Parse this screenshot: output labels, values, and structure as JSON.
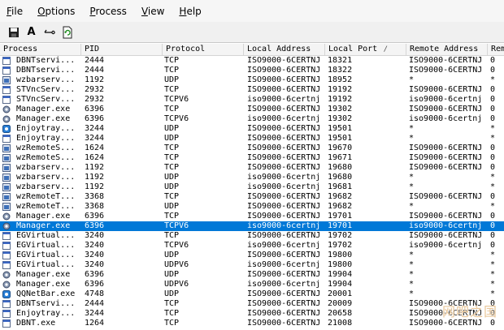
{
  "menu": [
    "File",
    "Options",
    "Process",
    "View",
    "Help"
  ],
  "toolbar": [
    {
      "name": "save-icon",
      "label": ""
    },
    {
      "name": "font-icon",
      "label": "A"
    },
    {
      "name": "options-icon",
      "label": "⊸"
    },
    {
      "name": "refresh-icon",
      "label": ""
    }
  ],
  "columns": [
    "Process",
    "PID",
    "Protocol",
    "Local Address",
    "Local Port",
    "Remote Address",
    "Rem"
  ],
  "sort_indicator": "/",
  "rows": [
    {
      "icon": "window",
      "process": "DBNTservi...",
      "pid": "2444",
      "protocol": "TCP",
      "local_address": "ISO9000-6CERTNJ",
      "local_port": "18321",
      "remote_address": "ISO9000-6CERTNJ",
      "rem": "0"
    },
    {
      "icon": "window",
      "process": "DBNTservi...",
      "pid": "2444",
      "protocol": "TCP",
      "local_address": "ISO9000-6CERTNJ",
      "local_port": "18322",
      "remote_address": "ISO9000-6CERTNJ",
      "rem": "0"
    },
    {
      "icon": "app",
      "process": "wzbarserv...",
      "pid": "1192",
      "protocol": "UDP",
      "local_address": "ISO9000-6CERTNJ",
      "local_port": "18952",
      "remote_address": "*",
      "rem": "*"
    },
    {
      "icon": "window",
      "process": "STVncServ...",
      "pid": "2932",
      "protocol": "TCP",
      "local_address": "ISO9000-6CERTNJ",
      "local_port": "19192",
      "remote_address": "ISO9000-6CERTNJ",
      "rem": "0"
    },
    {
      "icon": "window",
      "process": "STVncServ...",
      "pid": "2932",
      "protocol": "TCPV6",
      "local_address": "iso9000-6certnj",
      "local_port": "19192",
      "remote_address": "iso9000-6certnj",
      "rem": "0"
    },
    {
      "icon": "gear",
      "process": "Manager.exe",
      "pid": "6396",
      "protocol": "TCP",
      "local_address": "ISO9000-6CERTNJ",
      "local_port": "19302",
      "remote_address": "ISO9000-6CERTNJ",
      "rem": "0"
    },
    {
      "icon": "gear",
      "process": "Manager.exe",
      "pid": "6396",
      "protocol": "TCPV6",
      "local_address": "iso9000-6certnj",
      "local_port": "19302",
      "remote_address": "iso9000-6certnj",
      "rem": "0"
    },
    {
      "icon": "blue",
      "process": "Enjoytray...",
      "pid": "3244",
      "protocol": "UDP",
      "local_address": "ISO9000-6CERTNJ",
      "local_port": "19501",
      "remote_address": "*",
      "rem": "*"
    },
    {
      "icon": "window",
      "process": "Enjoytray...",
      "pid": "3244",
      "protocol": "UDP",
      "local_address": "ISO9000-6CERTNJ",
      "local_port": "19501",
      "remote_address": "*",
      "rem": "*"
    },
    {
      "icon": "app",
      "process": "wzRemoteS...",
      "pid": "1624",
      "protocol": "TCP",
      "local_address": "ISO9000-6CERTNJ",
      "local_port": "19670",
      "remote_address": "ISO9000-6CERTNJ",
      "rem": "0"
    },
    {
      "icon": "app",
      "process": "wzRemoteS...",
      "pid": "1624",
      "protocol": "TCP",
      "local_address": "ISO9000-6CERTNJ",
      "local_port": "19671",
      "remote_address": "ISO9000-6CERTNJ",
      "rem": "0"
    },
    {
      "icon": "app",
      "process": "wzbarserv...",
      "pid": "1192",
      "protocol": "TCP",
      "local_address": "ISO9000-6CERTNJ",
      "local_port": "19680",
      "remote_address": "ISO9000-6CERTNJ",
      "rem": "0"
    },
    {
      "icon": "app",
      "process": "wzbarserv...",
      "pid": "1192",
      "protocol": "UDP",
      "local_address": "iso9000-6certnj",
      "local_port": "19680",
      "remote_address": "*",
      "rem": "*"
    },
    {
      "icon": "app",
      "process": "wzbarserv...",
      "pid": "1192",
      "protocol": "UDP",
      "local_address": "iso9000-6certnj",
      "local_port": "19681",
      "remote_address": "*",
      "rem": "*"
    },
    {
      "icon": "app",
      "process": "wzRemoteT...",
      "pid": "3368",
      "protocol": "TCP",
      "local_address": "ISO9000-6CERTNJ",
      "local_port": "19682",
      "remote_address": "ISO9000-6CERTNJ",
      "rem": "0"
    },
    {
      "icon": "app",
      "process": "wzRemoteT...",
      "pid": "3368",
      "protocol": "UDP",
      "local_address": "ISO9000-6CERTNJ",
      "local_port": "19682",
      "remote_address": "*",
      "rem": "*"
    },
    {
      "icon": "gear",
      "process": "Manager.exe",
      "pid": "6396",
      "protocol": "TCP",
      "local_address": "ISO9000-6CERTNJ",
      "local_port": "19701",
      "remote_address": "ISO9000-6CERTNJ",
      "rem": "0"
    },
    {
      "icon": "gear",
      "process": "Manager.exe",
      "pid": "6396",
      "protocol": "TCPV6",
      "local_address": "iso9000-6certnj",
      "local_port": "19701",
      "remote_address": "iso9000-6certnj",
      "rem": "0",
      "selected": true
    },
    {
      "icon": "window",
      "process": "EGVirtual...",
      "pid": "3240",
      "protocol": "TCP",
      "local_address": "ISO9000-6CERTNJ",
      "local_port": "19702",
      "remote_address": "ISO9000-6CERTNJ",
      "rem": "0"
    },
    {
      "icon": "window",
      "process": "EGVirtual...",
      "pid": "3240",
      "protocol": "TCPV6",
      "local_address": "iso9000-6certnj",
      "local_port": "19702",
      "remote_address": "iso9000-6certnj",
      "rem": "0"
    },
    {
      "icon": "window",
      "process": "EGVirtual...",
      "pid": "3240",
      "protocol": "UDP",
      "local_address": "ISO9000-6CERTNJ",
      "local_port": "19800",
      "remote_address": "*",
      "rem": "*"
    },
    {
      "icon": "window",
      "process": "EGVirtual...",
      "pid": "3240",
      "protocol": "UDPV6",
      "local_address": "iso9000-6certnj",
      "local_port": "19800",
      "remote_address": "*",
      "rem": "*"
    },
    {
      "icon": "gear",
      "process": "Manager.exe",
      "pid": "6396",
      "protocol": "UDP",
      "local_address": "ISO9000-6CERTNJ",
      "local_port": "19904",
      "remote_address": "*",
      "rem": "*"
    },
    {
      "icon": "gear",
      "process": "Manager.exe",
      "pid": "6396",
      "protocol": "UDPV6",
      "local_address": "iso9000-6certnj",
      "local_port": "19904",
      "remote_address": "*",
      "rem": "*"
    },
    {
      "icon": "blue",
      "process": "QQNetBar.exe",
      "pid": "4748",
      "protocol": "UDP",
      "local_address": "ISO9000-6CERTNJ",
      "local_port": "20001",
      "remote_address": "*",
      "rem": "*"
    },
    {
      "icon": "window",
      "process": "DBNTservi...",
      "pid": "2444",
      "protocol": "TCP",
      "local_address": "ISO9000-6CERTNJ",
      "local_port": "20009",
      "remote_address": "ISO9000-6CERTNJ",
      "rem": "0"
    },
    {
      "icon": "window",
      "process": "Enjoytray...",
      "pid": "3244",
      "protocol": "TCP",
      "local_address": "ISO9000-6CERTNJ",
      "local_port": "20658",
      "remote_address": "ISO9000-6CERTNJ",
      "rem": "0"
    },
    {
      "icon": "window",
      "process": "DBNT.exe",
      "pid": "1264",
      "protocol": "TCP",
      "local_address": "ISO9000-6CERTNJ",
      "local_port": "21008",
      "remote_address": "ISO9000-6CERTNJ",
      "rem": "0"
    }
  ],
  "watermark": "网吧之国",
  "colors": {
    "selection": "#0078d7",
    "header_bg": "#f4f4f4",
    "menubar_bg": "#f6f6f6"
  }
}
